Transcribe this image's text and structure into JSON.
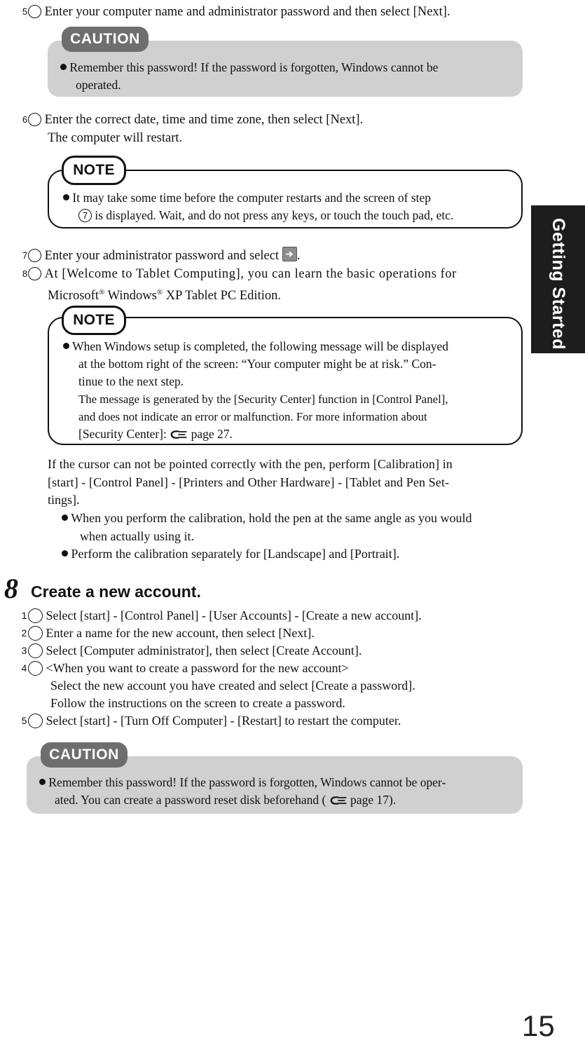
{
  "page": {
    "number": "15",
    "side_tab_label": "Getting Started"
  },
  "steps": {
    "s5": {
      "marker": "5",
      "text": "Enter your computer name and administrator password and then select [Next]."
    },
    "s6": {
      "marker": "6",
      "line1": "Enter the correct date, time and time zone, then select [Next].",
      "line2": "The computer will restart."
    },
    "s7": {
      "marker": "7",
      "text_before": "Enter your administrator password and select",
      "icon": "right-arrow-button-icon",
      "text_after": "."
    },
    "s8": {
      "marker": "8",
      "line1": "At [Welcome to Tablet Computing], you can learn the basic operations for",
      "line2_a": "Microsoft",
      "line2_sup1": "®",
      "line2_b": " Windows",
      "line2_sup2": "®",
      "line2_c": "  XP Tablet PC Edition."
    }
  },
  "caution_top": {
    "label": "CAUTION",
    "bullet_line1": "Remember this password!  If the password is forgotten, Windows cannot be",
    "bullet_line2": "operated."
  },
  "note_restart": {
    "label": "NOTE",
    "line1": "It may take some time before the computer restarts and the screen of step",
    "line2_marker": "7",
    "line2": "is displayed.  Wait, and do not press any keys, or touch the touch pad, etc."
  },
  "note_security": {
    "label": "NOTE",
    "line1": "When Windows setup is completed, the following message will be displayed",
    "line2": "at the bottom right of the screen: “Your computer might be at risk.”  Con-",
    "line3": "tinue to the next step.",
    "line4": "The message is generated by the [Security Center] function in [Control Panel],",
    "line5": "and does not indicate an error or malfunction. For more information about",
    "line6_prefix": "[Security Center]:",
    "line6_icon": "pointing-hand-icon",
    "line6_ref": "page 27."
  },
  "calibration": {
    "para_line1": "If the cursor can not be pointed correctly with the pen, perform [Calibration] in",
    "para_line2": "[start] - [Control Panel] - [Printers and Other Hardware] - [Tablet and Pen Set-",
    "para_line3": "tings].",
    "bullet1_line1": "When you perform the calibration, hold the pen at the same angle as you would",
    "bullet1_line2": "when actually using it.",
    "bullet2": "Perform the calibration separately for [Landscape] and [Portrait]."
  },
  "section8": {
    "number": "8",
    "title": "Create a new account.",
    "items": [
      {
        "marker": "1",
        "lines": [
          "Select [start] - [Control Panel] - [User Accounts] - [Create a new account]."
        ]
      },
      {
        "marker": "2",
        "lines": [
          "Enter a name for the new account, then select [Next]."
        ]
      },
      {
        "marker": "3",
        "lines": [
          "Select [Computer administrator], then select [Create Account]."
        ]
      },
      {
        "marker": "4",
        "lines": [
          "<When you want to create a password for the new account>",
          "Select the new account you have created and select [Create a password].",
          "Follow the instructions on the screen to create a password."
        ]
      },
      {
        "marker": "5",
        "lines": [
          "Select [start] - [Turn Off Computer] - [Restart] to restart the computer."
        ]
      }
    ]
  },
  "caution_bottom": {
    "label": "CAUTION",
    "bullet_line1": "Remember this password!  If the password is forgotten, Windows cannot be oper-",
    "bullet_line2_prefix": "ated.  You can create a password reset disk beforehand (",
    "bullet_line2_icon": "pointing-hand-icon",
    "bullet_line2_ref": "page 17)."
  },
  "colors": {
    "caution_body": "#d0d0d0",
    "caution_tab": "#6e6e6e",
    "side_tab": "#1d1d1d",
    "text": "#111111",
    "arrow_button": "#8d8d8d"
  }
}
